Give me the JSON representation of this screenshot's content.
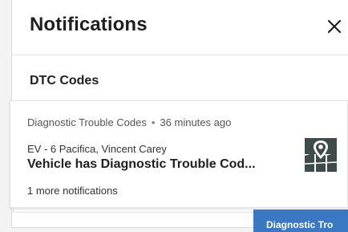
{
  "panel": {
    "title": "Notifications",
    "close_icon": "close-icon"
  },
  "section": {
    "title": "DTC Codes"
  },
  "notification": {
    "category": "Diagnostic Trouble Codes",
    "separator": "•",
    "time": "36 minutes ago",
    "vehicle": "EV - 6 Pacifica, Vincent Carey",
    "headline": "Vehicle has Diagnostic Trouble Cod...",
    "more": "1 more notifications",
    "icon": "map-pin-icon"
  },
  "toast": {
    "label": "Diagnostic Tro"
  },
  "colors": {
    "accent": "#3a78c3",
    "icon": "#3f4a4a"
  }
}
